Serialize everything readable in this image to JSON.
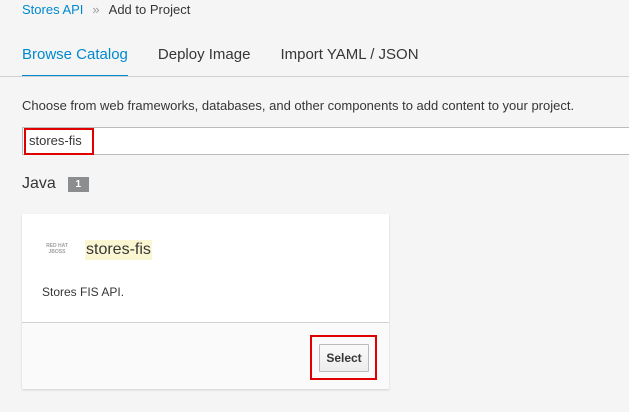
{
  "breadcrumb": {
    "project_link": "Stores API",
    "separator": "»",
    "current": "Add to Project"
  },
  "tabs": [
    {
      "label": "Browse Catalog",
      "active": true
    },
    {
      "label": "Deploy Image",
      "active": false
    },
    {
      "label": "Import YAML / JSON",
      "active": false
    }
  ],
  "intro_text": "Choose from web frameworks, databases, and other components to add content to your project.",
  "filter": {
    "value": "stores-fis"
  },
  "category": {
    "name": "Java",
    "count": "1"
  },
  "card": {
    "logo_text_line1": "RED HAT",
    "logo_text_line2": "JBOSS",
    "title": "stores-fis",
    "description": "Stores FIS API.",
    "select_label": "Select"
  },
  "colors": {
    "accent": "#0088ce",
    "highlight_box": "#e00000",
    "badge": "#8b8d8f"
  }
}
